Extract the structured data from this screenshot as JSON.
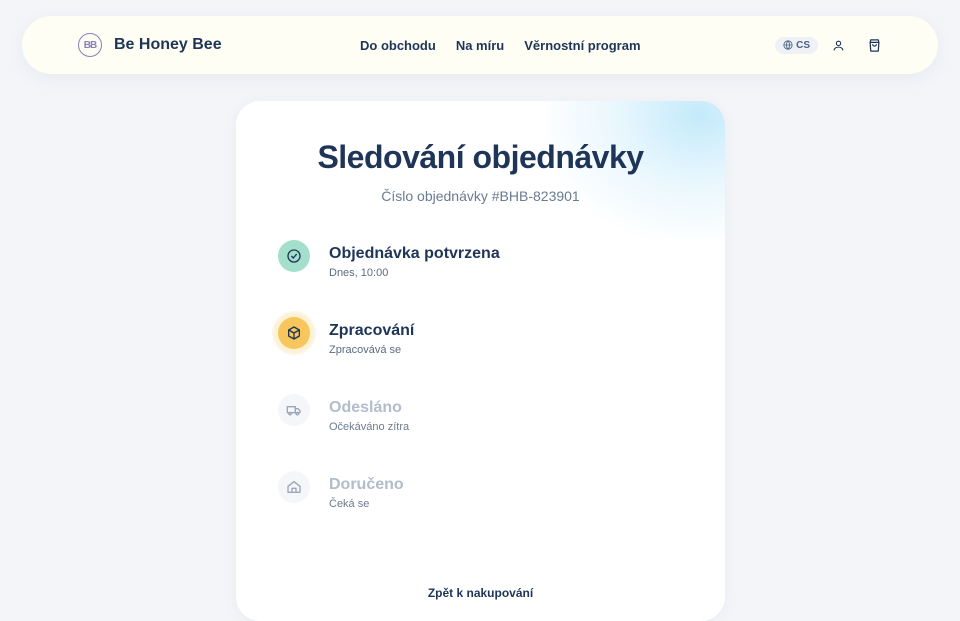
{
  "header": {
    "brand_name": "Be Honey Bee",
    "logo_text": "BB",
    "nav": [
      "Do obchodu",
      "Na míru",
      "Věrnostní program"
    ],
    "lang": "CS"
  },
  "tracking": {
    "title": "Sledování objednávky",
    "order_number": "Číslo objednávky #BHB-823901",
    "steps": [
      {
        "title": "Objednávka potvrzena",
        "subtitle": "Dnes, 10:00",
        "status": "done",
        "icon": "check-icon"
      },
      {
        "title": "Zpracování",
        "subtitle": "Zpracovává se",
        "status": "active",
        "icon": "box-icon"
      },
      {
        "title": "Odesláno",
        "subtitle": "Očekáváno zítra",
        "status": "pending",
        "icon": "truck-icon"
      },
      {
        "title": "Doručeno",
        "subtitle": "Čeká se",
        "status": "pending",
        "icon": "home-icon"
      }
    ],
    "back_link": "Zpět k nakupování"
  },
  "colors": {
    "primary_text": "#1e3557",
    "done": "#a3dfcb",
    "active": "#f7c65c",
    "pending_text": "#b2bccb"
  }
}
